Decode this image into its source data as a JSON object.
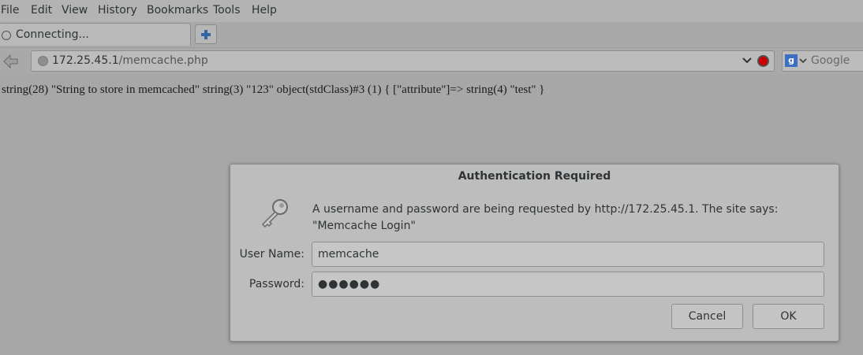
{
  "menu": {
    "file": "File",
    "edit": "Edit",
    "view": "View",
    "history": "History",
    "bookmarks": "Bookmarks",
    "tools": "Tools",
    "help": "Help"
  },
  "tab": {
    "title": "Connecting..."
  },
  "urlbar": {
    "host": "172.25.45.1",
    "path": "/memcache.php"
  },
  "search": {
    "placeholder": "Google"
  },
  "page": {
    "output": "string(28) \"String to store in memcached\" string(3) \"123\" object(stdClass)#3 (1) { [\"attribute\"]=> string(4) \"test\" }"
  },
  "dialog": {
    "title": "Authentication Required",
    "message": "A username and password are being requested by http://172.25.45.1. The site says: \"Memcache Login\"",
    "username_label": "User Name:",
    "username_value": "memcache",
    "password_label": "Password:",
    "password_value": "●●●●●●",
    "cancel_label": "Cancel",
    "ok_label": "OK"
  },
  "colors": {
    "stop": "#cc0000",
    "google": "#3d6ec5"
  }
}
